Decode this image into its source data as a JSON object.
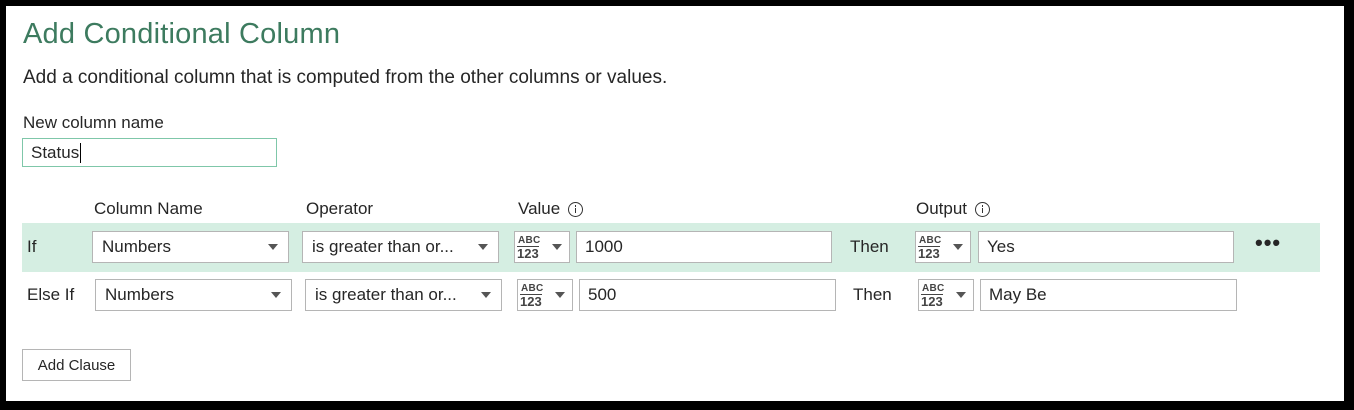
{
  "dialog": {
    "title": "Add Conditional Column",
    "subtitle": "Add a conditional column that is computed from the other columns or values.",
    "new_column_label": "New column name",
    "new_column_value": "Status"
  },
  "headers": {
    "column_name": "Column Name",
    "operator": "Operator",
    "value": "Value",
    "output": "Output"
  },
  "type_picker": {
    "top": "ABC",
    "bottom": "123"
  },
  "clauses": [
    {
      "label": "If",
      "column": "Numbers",
      "operator": "is greater than or...",
      "value": "1000",
      "then": "Then",
      "output": "Yes"
    },
    {
      "label": "Else If",
      "column": "Numbers",
      "operator": "is greater than or...",
      "value": "500",
      "then": "Then",
      "output": "May Be"
    }
  ],
  "more_glyph": "•••",
  "add_clause_label": "Add Clause",
  "colors": {
    "title": "#3d7b5f",
    "active_row": "#d5eee2",
    "input_focus_border": "#7fc7a9"
  }
}
